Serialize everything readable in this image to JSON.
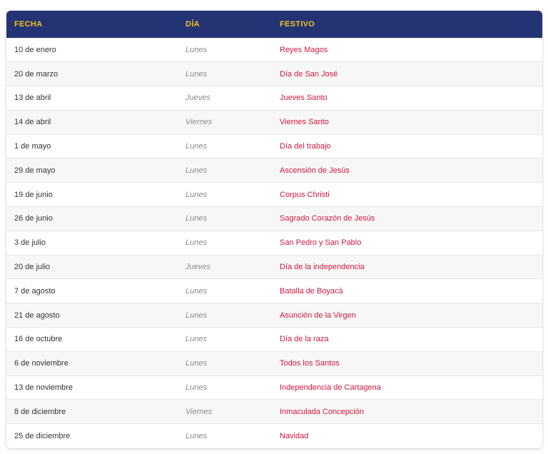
{
  "colors": {
    "header_bg": "#243374",
    "header_text": "#f2c224",
    "holiday_text": "#d0173f",
    "day_text": "#8a8a8a",
    "date_text": "#333333"
  },
  "table": {
    "headers": [
      "FECHA",
      "DÍA",
      "FESTIVO"
    ],
    "rows": [
      {
        "fecha": "10 de enero",
        "dia": "Lunes",
        "festivo": "Reyes Magos"
      },
      {
        "fecha": "20 de marzo",
        "dia": "Lunes",
        "festivo": "Día de San José"
      },
      {
        "fecha": "13 de abril",
        "dia": "Jueves",
        "festivo": "Jueves Santo"
      },
      {
        "fecha": "14 de abril",
        "dia": "Viernes",
        "festivo": "Viernes Santo"
      },
      {
        "fecha": "1 de mayo",
        "dia": "Lunes",
        "festivo": "Día del trabajo"
      },
      {
        "fecha": "29 de mayo",
        "dia": "Lunes",
        "festivo": "Ascensión de Jesús"
      },
      {
        "fecha": "19 de junio",
        "dia": "Lunes",
        "festivo": "Corpus Christi"
      },
      {
        "fecha": "26 de junio",
        "dia": "Lunes",
        "festivo": "Sagrado Corazón de Jesús"
      },
      {
        "fecha": "3 de julio",
        "dia": "Lunes",
        "festivo": "San Pedro y San Pablo"
      },
      {
        "fecha": "20 de julio",
        "dia": "Jueves",
        "festivo": "Día de la independencia"
      },
      {
        "fecha": "7 de agosto",
        "dia": "Lunes",
        "festivo": "Batalla de Boyacá"
      },
      {
        "fecha": "21 de agosto",
        "dia": "Lunes",
        "festivo": "Asunción de la Virgen"
      },
      {
        "fecha": "16 de octubre",
        "dia": "Lunes",
        "festivo": "Día de la raza"
      },
      {
        "fecha": "6 de noviembre",
        "dia": "Lunes",
        "festivo": "Todos los Santos"
      },
      {
        "fecha": "13 de noviembre",
        "dia": "Lunes",
        "festivo": "Independencia de Cartagena"
      },
      {
        "fecha": "8 de diciembre",
        "dia": "Viernes",
        "festivo": "Inmaculada Concepción"
      },
      {
        "fecha": "25 de diciembre",
        "dia": "Lunes",
        "festivo": "Navidad"
      }
    ]
  }
}
